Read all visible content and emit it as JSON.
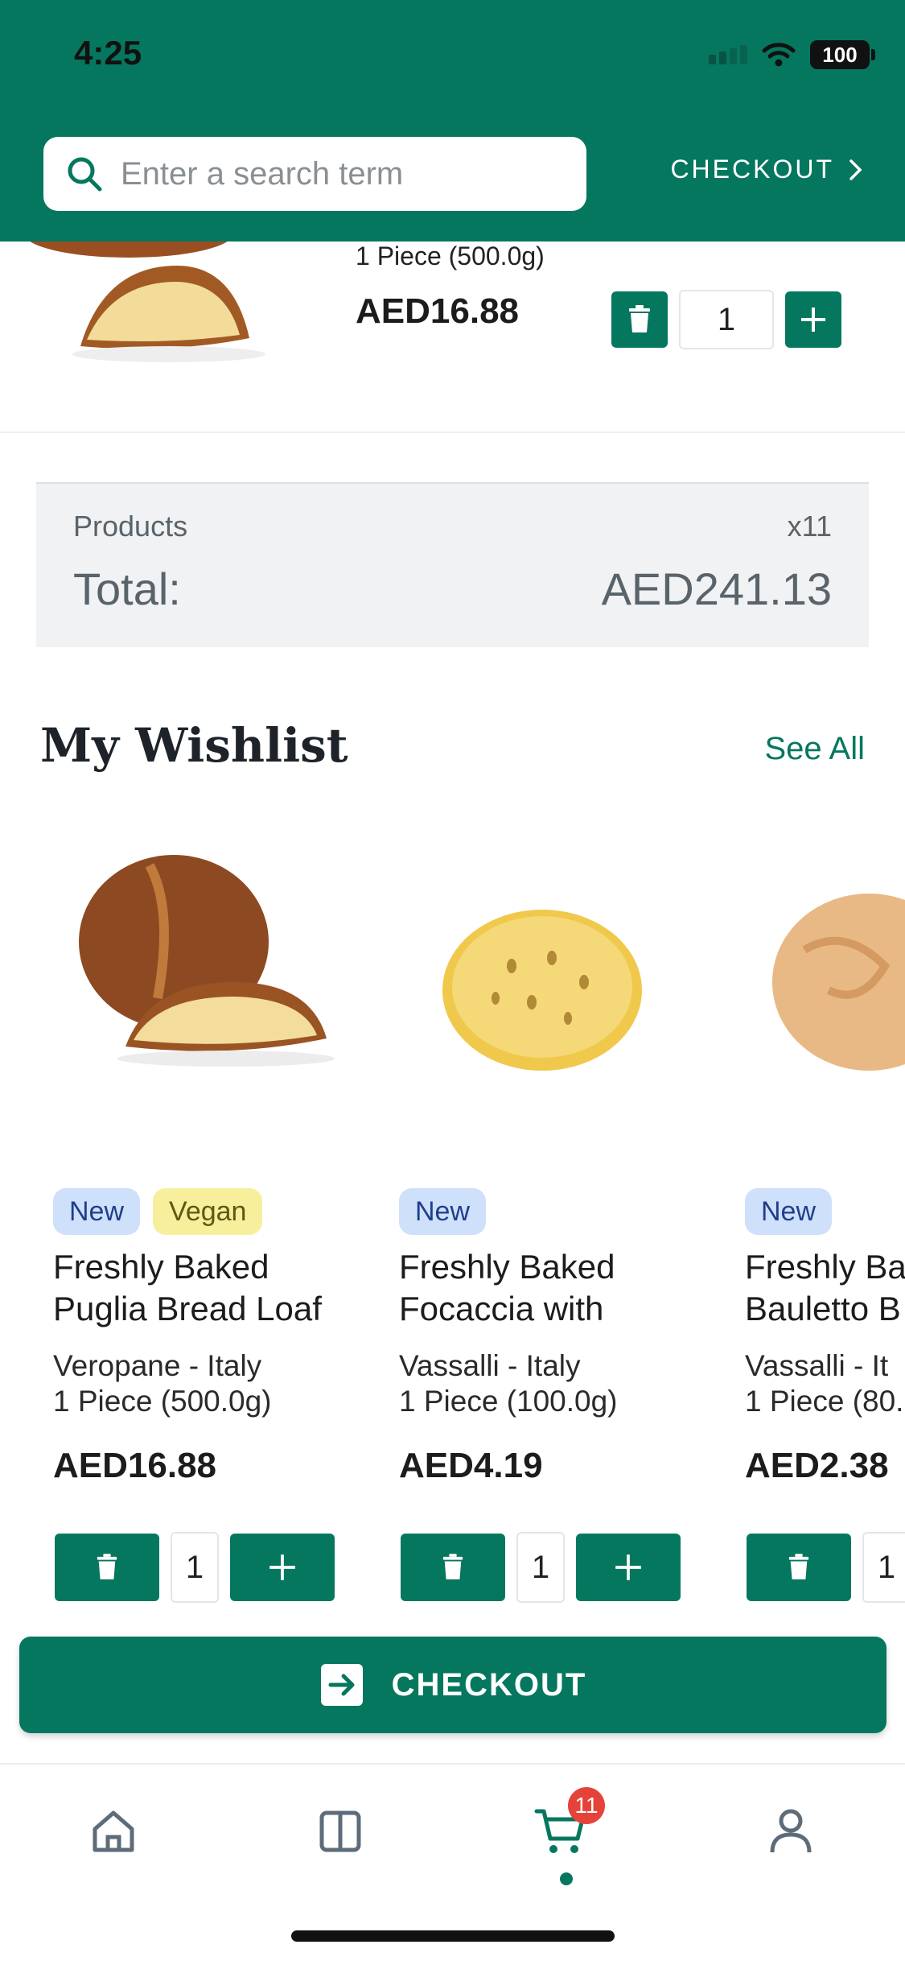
{
  "status_bar": {
    "time": "4:25",
    "battery": "100"
  },
  "header": {
    "search_placeholder": "Enter a search term",
    "checkout_label": "CHECKOUT"
  },
  "cart_item": {
    "weight": "1 Piece (500.0g)",
    "price": "AED16.88",
    "quantity": "1"
  },
  "totals": {
    "products_label": "Products",
    "products_count": "x11",
    "total_label": "Total:",
    "total_amount": "AED241.13"
  },
  "wishlist": {
    "title": "My Wishlist",
    "see_all": "See All",
    "products": [
      {
        "tags": [
          "New",
          "Vegan"
        ],
        "name": "Freshly Baked\nPuglia Bread Loaf",
        "brand": "Veropane - Italy",
        "size": "1 Piece (500.0g)",
        "price": "AED16.88",
        "quantity": "1"
      },
      {
        "tags": [
          "New"
        ],
        "name": "Freshly Baked\nFocaccia with",
        "brand": "Vassalli - Italy",
        "size": "1 Piece (100.0g)",
        "price": "AED4.19",
        "quantity": "1"
      },
      {
        "tags": [
          "New"
        ],
        "name": "Freshly Ba\nBauletto B",
        "brand": "Vassalli - It",
        "size": "1 Piece (80.",
        "price": "AED2.38",
        "quantity": "1"
      }
    ]
  },
  "checkout_button": {
    "label": "CHECKOUT"
  },
  "bottom_nav": {
    "items": [
      "home-icon",
      "catalog-icon",
      "cart-icon",
      "profile-icon"
    ],
    "cart_badge": "11",
    "active": "cart"
  },
  "colors": {
    "brand_green": "#06775f",
    "badge_red": "#e5433a",
    "tag_new_bg": "#cfe0fb",
    "tag_vegan_bg": "#f7ef9c"
  }
}
